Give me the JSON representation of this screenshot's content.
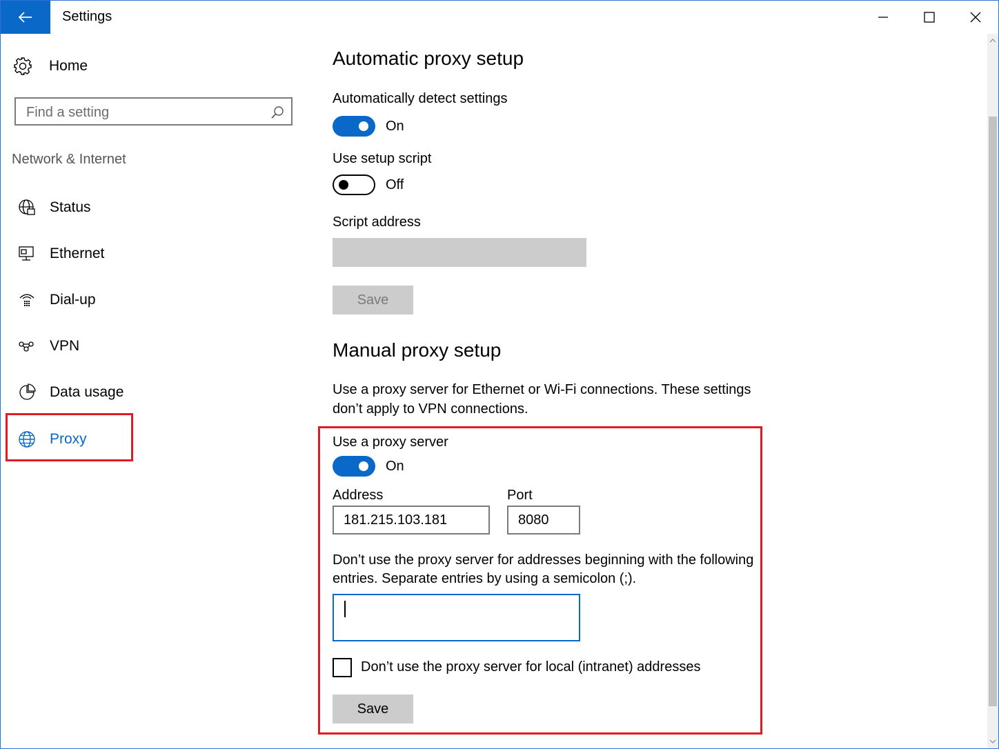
{
  "window": {
    "title": "Settings",
    "accent": "#0a68c9",
    "highlight": "#e01b24"
  },
  "sidebar": {
    "home_label": "Home",
    "search_placeholder": "Find a setting",
    "section_heading": "Network & Internet",
    "items": [
      {
        "label": "Status",
        "icon": "globe-status-icon"
      },
      {
        "label": "Ethernet",
        "icon": "ethernet-icon"
      },
      {
        "label": "Dial-up",
        "icon": "dialup-icon"
      },
      {
        "label": "VPN",
        "icon": "vpn-icon"
      },
      {
        "label": "Data usage",
        "icon": "data-usage-icon"
      },
      {
        "label": "Proxy",
        "icon": "globe-icon",
        "active": true
      }
    ]
  },
  "auto": {
    "heading": "Automatic proxy setup",
    "detect_label": "Automatically detect settings",
    "detect_state": "On",
    "script_label": "Use setup script",
    "script_state": "Off",
    "address_label": "Script address",
    "address_value": "",
    "save_label": "Save"
  },
  "manual": {
    "heading": "Manual proxy setup",
    "description": "Use a proxy server for Ethernet or Wi-Fi connections. These settings don’t apply to VPN connections.",
    "use_proxy_label": "Use a proxy server",
    "use_proxy_state": "On",
    "address_label": "Address",
    "address_value": "181.215.103.181",
    "port_label": "Port",
    "port_value": "8080",
    "exceptions_desc": "Don’t use the proxy server for addresses beginning with the following entries. Separate entries by using a semicolon (;).",
    "exceptions_value": "",
    "local_label": "Don’t use the proxy server for local (intranet) addresses",
    "local_checked": false,
    "save_label": "Save"
  }
}
